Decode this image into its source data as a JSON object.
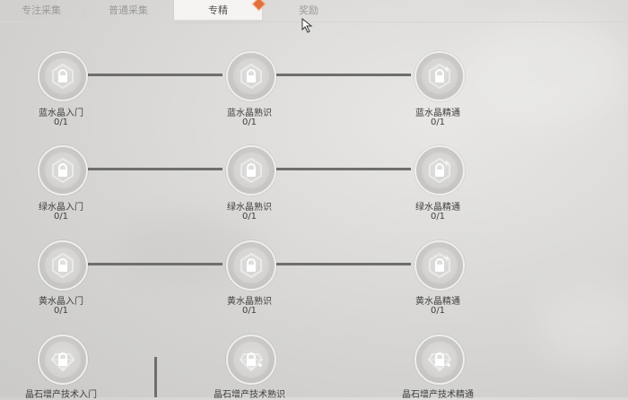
{
  "tabs": [
    {
      "label": "专注采集"
    },
    {
      "label": "普通采集"
    },
    {
      "label": "专精"
    },
    {
      "label": "奖励"
    }
  ],
  "skills": [
    [
      {
        "label": "蓝水晶入门",
        "progress": "0/1",
        "icon": "crystal-icon"
      },
      {
        "label": "蓝水晶熟识",
        "progress": "0/1",
        "icon": "crystal-icon"
      },
      {
        "label": "蓝水晶精通",
        "progress": "0/1",
        "icon": "crystal-icon"
      }
    ],
    [
      {
        "label": "绿水晶入门",
        "progress": "0/1",
        "icon": "crystal-icon"
      },
      {
        "label": "绿水晶熟识",
        "progress": "0/1",
        "icon": "crystal-icon"
      },
      {
        "label": "绿水晶精通",
        "progress": "0/1",
        "icon": "crystal-icon"
      }
    ],
    [
      {
        "label": "黄水晶入门",
        "progress": "0/1",
        "icon": "crystal-icon"
      },
      {
        "label": "黄水晶熟识",
        "progress": "0/1",
        "icon": "crystal-icon"
      },
      {
        "label": "黄水晶精通",
        "progress": "0/1",
        "icon": "crystal-icon"
      }
    ],
    [
      {
        "label": "晶石增产技术入门",
        "progress": "",
        "icon": "gem-boost-icon"
      },
      {
        "label": "晶石增产技术熟识",
        "progress": "",
        "icon": "gem-boost-icon"
      },
      {
        "label": "晶石增产技术精通",
        "progress": "",
        "icon": "gem-boost-icon"
      }
    ]
  ],
  "colors": {
    "active_tab_bg": "#f5f4f2",
    "badge": "#e3703a",
    "connector": "#6e6e6e"
  }
}
